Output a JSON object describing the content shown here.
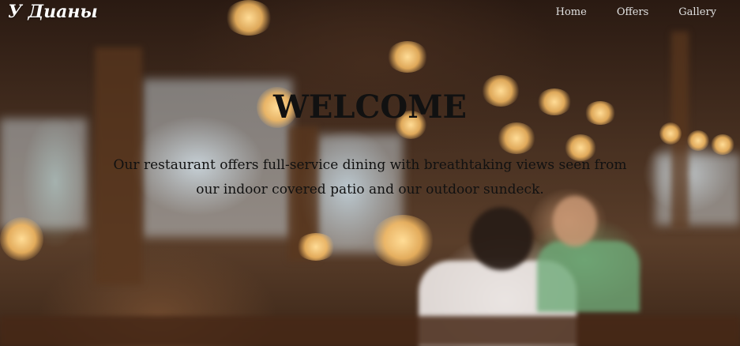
{
  "navbar": {
    "brand": "У Дианы",
    "links": [
      {
        "label": "Home"
      },
      {
        "label": "Offers"
      },
      {
        "label": "Gallery"
      }
    ]
  },
  "hero": {
    "title": "WELCOME",
    "text": "Our restaurant offers full-service dining with breathtaking views seen from our indoor covered patio and our outdoor sundeck."
  },
  "colors": {
    "brand_text": "#ffffff",
    "nav_text": "#e0e0e0",
    "hero_text": "#111111"
  }
}
